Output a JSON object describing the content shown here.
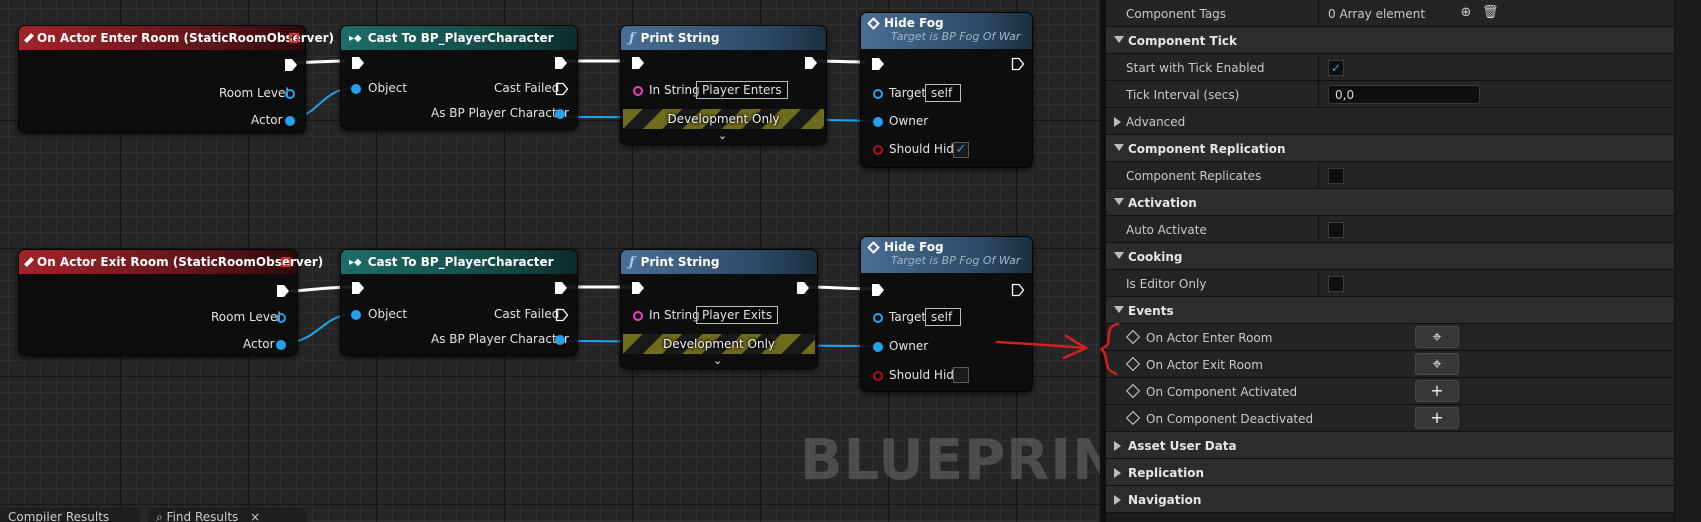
{
  "graph": {
    "row1": {
      "event": {
        "title": "On Actor Enter Room (StaticRoomObserver)",
        "pins": [
          "Room Level",
          "Actor"
        ]
      },
      "cast": {
        "title": "Cast To BP_PlayerCharacter",
        "in_pin": "Object",
        "fail_pin": "Cast Failed",
        "out_pin": "As BP Player Character"
      },
      "print": {
        "title": "Print String",
        "in_label": "In String",
        "in_value": "Player Enters",
        "dev_only": "Development Only"
      },
      "hide": {
        "title": "Hide Fog",
        "subtitle": "Target is BP Fog Of War",
        "target_label": "Target",
        "target_value": "self",
        "owner_label": "Owner",
        "hide_label": "Should Hide",
        "hide_checked": "✓"
      }
    },
    "row2": {
      "event": {
        "title": "On Actor Exit Room (StaticRoomObserver)",
        "pins": [
          "Room Level",
          "Actor"
        ]
      },
      "cast": {
        "title": "Cast To BP_PlayerCharacter",
        "in_pin": "Object",
        "fail_pin": "Cast Failed",
        "out_pin": "As BP Player Character"
      },
      "print": {
        "title": "Print String",
        "in_label": "In String",
        "in_value": "Player Exits",
        "dev_only": "Development Only"
      },
      "hide": {
        "title": "Hide Fog",
        "subtitle": "Target is BP Fog Of War",
        "target_label": "Target",
        "target_value": "self",
        "owner_label": "Owner",
        "hide_label": "Should Hide",
        "hide_checked": ""
      }
    },
    "watermark": "BLUEPRINT",
    "tabs": [
      "Compiler Results",
      "Find Results"
    ]
  },
  "details": {
    "component_tags": {
      "label": "Component Tags",
      "value": "0 Array element"
    },
    "component_tick": {
      "label": "Component Tick",
      "start_with_tick": {
        "label": "Start with Tick Enabled",
        "checked": "✓"
      },
      "tick_interval": {
        "label": "Tick Interval (secs)",
        "value": "0,0"
      }
    },
    "advanced": "Advanced",
    "replication": {
      "label": "Component Replication",
      "replicates": "Component Replicates"
    },
    "activation": {
      "label": "Activation",
      "auto_activate": "Auto Activate"
    },
    "cooking": {
      "label": "Cooking",
      "editor_only": "Is Editor Only"
    },
    "events": {
      "label": "Events",
      "items": [
        {
          "name": "On Actor Enter Room",
          "button": "⌖"
        },
        {
          "name": "On Actor Exit Room",
          "button": "⌖"
        },
        {
          "name": "On Component Activated",
          "button": "+"
        },
        {
          "name": "On Component Deactivated",
          "button": "+"
        }
      ]
    },
    "asset_user_data": "Asset User Data",
    "replication_cat": "Replication",
    "navigation": "Navigation"
  },
  "colors": {
    "exec": "#ffffff",
    "object_pin": "#22a3f0",
    "string_pin": "#f03ec6",
    "bool_pin": "#b31010",
    "annotation": "#d41f1f"
  },
  "icons": [
    "event-diamond-icon",
    "function-icon",
    "cast-icon",
    "add-icon",
    "trash-icon",
    "goto-event-icon",
    "chevron-down-icon"
  ]
}
